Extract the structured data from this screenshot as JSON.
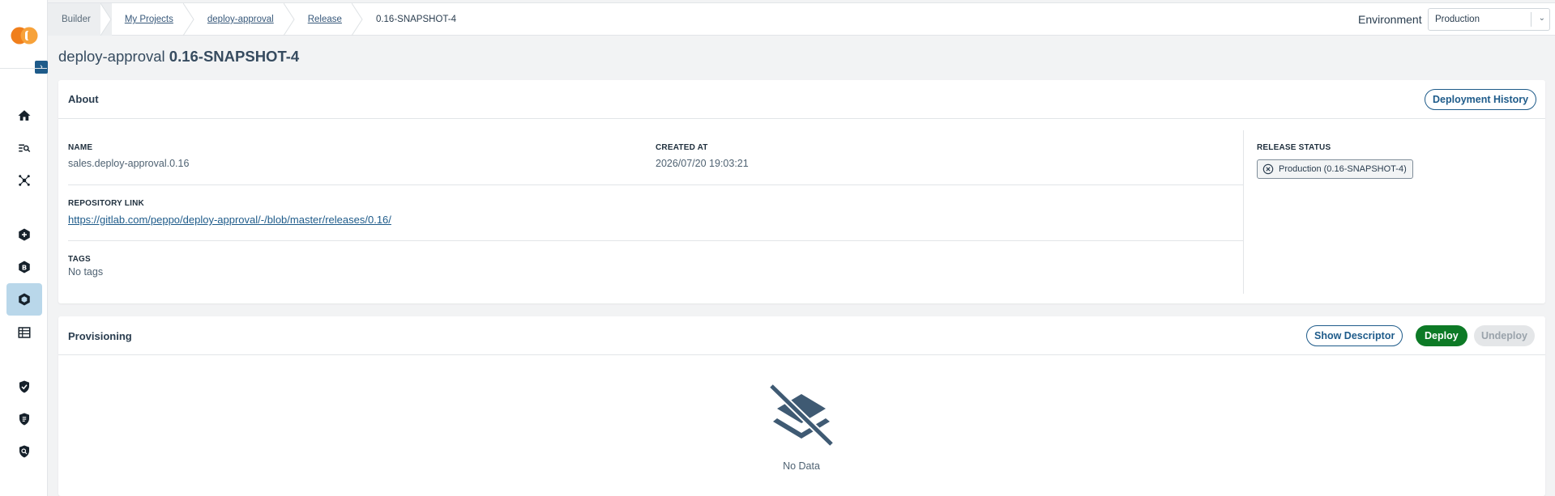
{
  "breadcrumb": {
    "items": [
      {
        "label": "Builder"
      },
      {
        "label": "My Projects"
      },
      {
        "label": "deploy-approval"
      },
      {
        "label": "Release"
      },
      {
        "label": "0.16-SNAPSHOT-4"
      }
    ]
  },
  "environment": {
    "label": "Environment",
    "selected": "Production"
  },
  "page": {
    "title_prefix": "deploy-approval",
    "title_version": "0.16-SNAPSHOT-4"
  },
  "about": {
    "title": "About",
    "history_button": "Deployment History",
    "name_label": "NAME",
    "name_value": "sales.deploy-approval.0.16",
    "created_label": "CREATED AT",
    "created_value": "2026/07/20 19:03:21",
    "repo_label": "REPOSITORY LINK",
    "repo_value": "https://gitlab.com/peppo/deploy-approval/-/blob/master/releases/0.16/",
    "tags_label": "TAGS",
    "tags_value": "No tags",
    "release_status_label": "RELEASE STATUS",
    "release_status_badge": "Production (0.16-SNAPSHOT-4)"
  },
  "provisioning": {
    "title": "Provisioning",
    "show_descriptor": "Show Descriptor",
    "deploy": "Deploy",
    "undeploy": "Undeploy",
    "empty_text": "No Data"
  },
  "sidebar": {
    "items": [
      {
        "icon": "home-icon"
      },
      {
        "icon": "search-list-icon"
      },
      {
        "icon": "network-icon"
      },
      {
        "icon": "plus-hex-icon"
      },
      {
        "icon": "builder-b-icon"
      },
      {
        "icon": "release-hex-icon",
        "active": true
      },
      {
        "icon": "table-icon"
      },
      {
        "icon": "shield-check-icon"
      },
      {
        "icon": "shield-doc-icon"
      },
      {
        "icon": "shield-search-icon"
      }
    ]
  },
  "colors": {
    "accent": "#1e5b8a",
    "deploy_green": "#0d7a26",
    "logo_orange": "#f07f1c",
    "active_nav": "#b9d7ea"
  }
}
